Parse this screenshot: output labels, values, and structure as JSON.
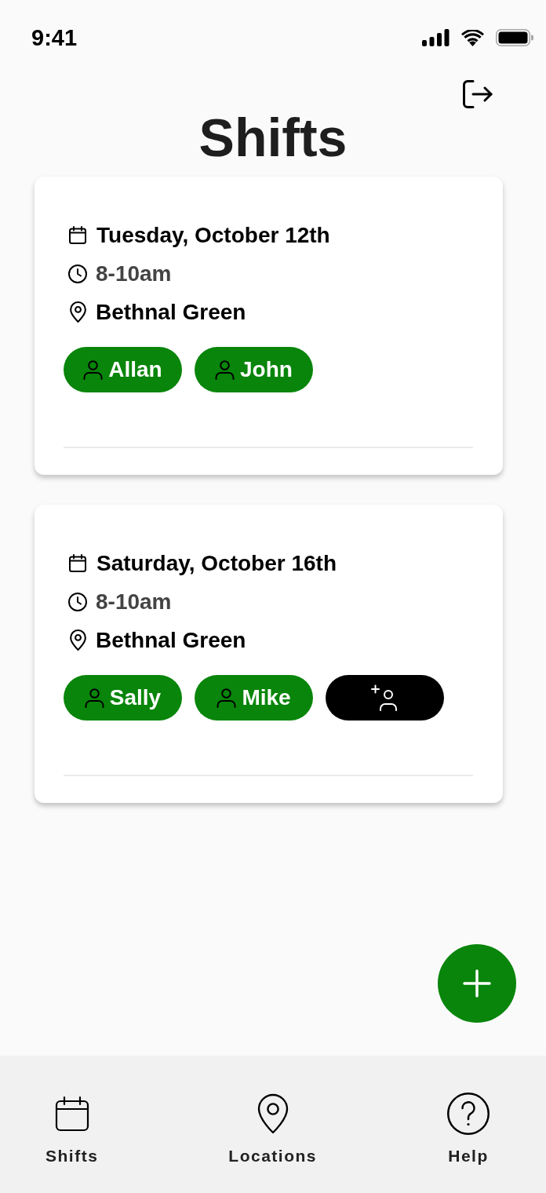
{
  "status_bar": {
    "time": "9:41"
  },
  "header": {
    "title": "Shifts"
  },
  "shifts": [
    {
      "date": "Tuesday, October 12th",
      "time": "8-10am",
      "location": "Bethnal Green",
      "chips": [
        {
          "kind": "person",
          "name": "Allan"
        },
        {
          "kind": "person",
          "name": "John"
        }
      ]
    },
    {
      "date": "Saturday, October 16th",
      "time": "8-10am",
      "location": "Bethnal Green",
      "chips": [
        {
          "kind": "person",
          "name": "Sally"
        },
        {
          "kind": "person",
          "name": "Mike"
        },
        {
          "kind": "add"
        }
      ]
    }
  ],
  "bottom_nav": [
    {
      "label": "Shifts"
    },
    {
      "label": "Locations"
    },
    {
      "label": "Help"
    }
  ]
}
